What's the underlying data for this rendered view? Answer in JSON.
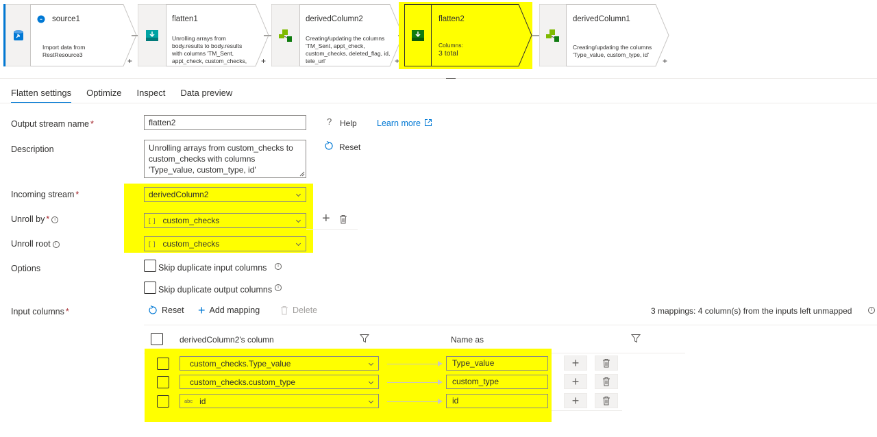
{
  "pipeline": {
    "nodes": [
      {
        "title": "source1",
        "desc": "Import data from RestResource3"
      },
      {
        "title": "flatten1",
        "desc": "Unrolling arrays from body.results to body.results with columns 'TM_Sent, appt_check, custom_checks, deleted_flag, id..."
      },
      {
        "title": "derivedColumn2",
        "desc": "Creating/updating the columns 'TM_Sent, appt_check, custom_checks, deleted_flag, id, tele_url'"
      },
      {
        "title": "flatten2",
        "desc_label": "Columns:",
        "desc_value": "3 total"
      },
      {
        "title": "derivedColumn1",
        "desc": "Creating/updating the columns 'Type_value, custom_type, id'"
      }
    ],
    "add_symbol": "+"
  },
  "tabs": [
    "Flatten settings",
    "Optimize",
    "Inspect",
    "Data preview"
  ],
  "form": {
    "output_stream_label": "Output stream name",
    "output_stream_value": "flatten2",
    "description_label": "Description",
    "description_value": "Unrolling arrays from custom_checks to custom_checks with columns 'Type_value, custom_type, id'",
    "help_label": "Help",
    "learn_more_label": "Learn more",
    "reset_label": "Reset",
    "incoming_stream_label": "Incoming stream",
    "incoming_stream_value": "derivedColumn2",
    "unroll_by_label": "Unroll by",
    "unroll_by_value": "custom_checks",
    "unroll_root_label": "Unroll root",
    "unroll_root_value": "custom_checks",
    "array_icon_text": "[ ]",
    "options_label": "Options",
    "skip_input_label": "Skip duplicate input columns",
    "skip_output_label": "Skip duplicate output columns",
    "input_columns_label": "Input columns",
    "required_mark": "*",
    "info_mark": "i"
  },
  "mapping": {
    "reset_label": "Reset",
    "add_mapping_label": "Add mapping",
    "delete_label": "Delete",
    "summary": "3 mappings: 4 column(s) from the inputs left unmapped",
    "col_source_header": "derivedColumn2's column",
    "col_name_header": "Name as",
    "rows": [
      {
        "source": "custom_checks.Type_value",
        "name": "Type_value",
        "type_icon": ""
      },
      {
        "source": "custom_checks.custom_type",
        "name": "custom_type",
        "type_icon": ""
      },
      {
        "source": "id",
        "name": "id",
        "type_icon": "abc"
      }
    ]
  },
  "colors": {
    "highlight": "#ffff00",
    "accent": "#0078d4",
    "node_green": "#107c10",
    "node_teal": "#00a3a3"
  }
}
